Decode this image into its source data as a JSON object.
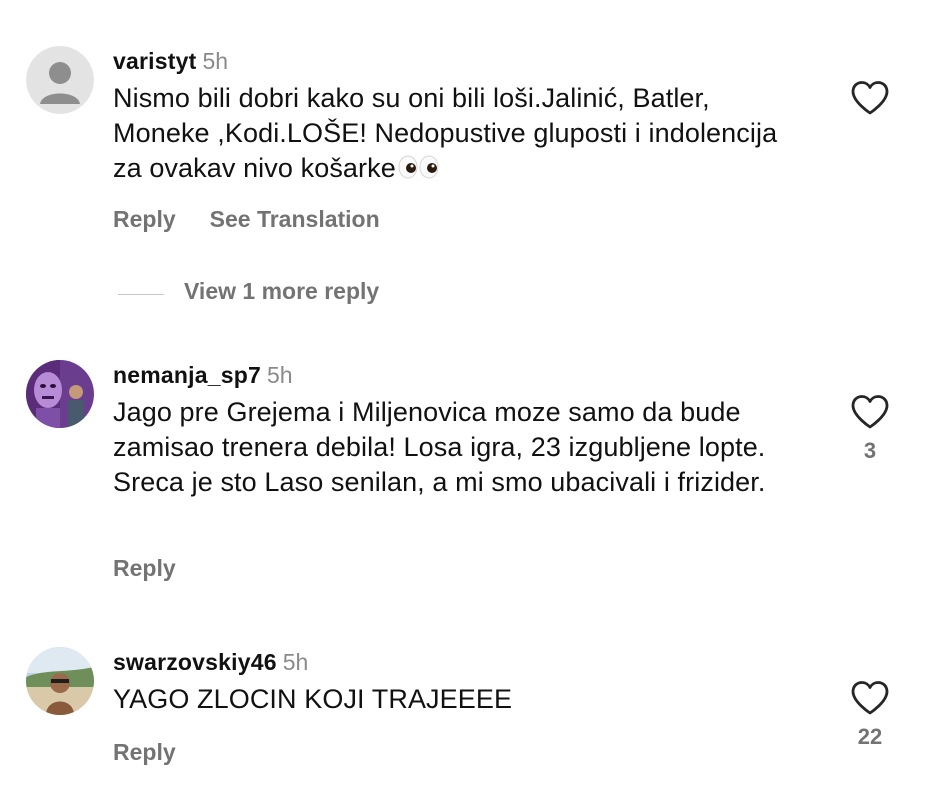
{
  "comments": [
    {
      "username": "varistyt",
      "time": "5h",
      "text": "Nismo bili dobri kako su oni bili loši.Jalinić, Batler, Moneke ,Kodi.LOŠE! Nedopustive gluposti i indolencija za ovakav nivo košarke",
      "emoji": "👀",
      "actions": {
        "reply": "Reply",
        "translate": "See Translation"
      },
      "likes": "",
      "avatar": "default-avatar-icon"
    },
    {
      "username": "nemanja_sp7",
      "time": "5h",
      "text": "Jago pre Grejema i Miljenovica moze samo da bude zamisao trenera debila! Losa igra, 23 izgubljene lopte. Sreca je sto Laso senilan, a mi smo ubacivali i frizider.",
      "actions": {
        "reply": "Reply"
      },
      "likes": "3",
      "avatar": "profile-photo"
    },
    {
      "username": "swarzovskiy46",
      "time": "5h",
      "text": "YAGO ZLOCIN KOJI TRAJEEEE",
      "actions": {
        "reply": "Reply"
      },
      "likes": "22",
      "avatar": "profile-photo"
    }
  ],
  "view_more_replies": "View 1 more reply",
  "colors": {
    "text": "#111111",
    "secondary": "#737373",
    "timestamp": "#8a8a8a"
  }
}
